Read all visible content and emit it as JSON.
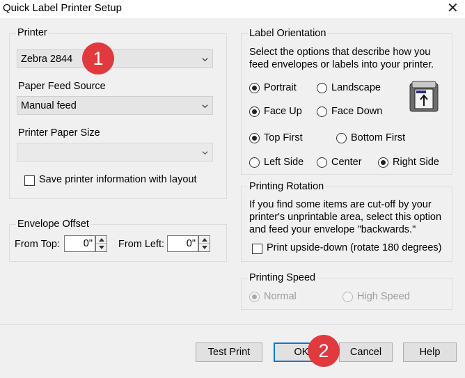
{
  "window": {
    "title": "Quick Label Printer Setup",
    "close_glyph": "✕"
  },
  "printer_group": {
    "legend": "Printer",
    "printer_selected": "Zebra 2844",
    "paper_feed_label": "Paper Feed Source",
    "paper_feed_selected": "Manual feed",
    "paper_size_label": "Printer Paper Size",
    "paper_size_selected": "",
    "save_info_label": "Save printer information with layout",
    "save_info_checked": false
  },
  "envelope_offset": {
    "legend": "Envelope Offset",
    "from_top_label": "From Top:",
    "from_top_value": "0\"",
    "from_left_label": "From Left:",
    "from_left_value": "0\""
  },
  "label_orientation": {
    "legend": "Label Orientation",
    "description": "Select the options that describe how you feed envelopes or labels into your printer.",
    "options": {
      "portrait": "Portrait",
      "landscape": "Landscape",
      "face_up": "Face Up",
      "face_down": "Face Down",
      "top_first": "Top First",
      "bottom_first": "Bottom First",
      "left_side": "Left Side",
      "center": "Center",
      "right_side": "Right Side"
    },
    "selected": {
      "orientation": "Portrait",
      "face": "Face Up",
      "order": "Top First",
      "side": "Right Side"
    },
    "preview_icon": "printer-feed-icon"
  },
  "printing_rotation": {
    "legend": "Printing Rotation",
    "description": "If you find some items are cut-off by your printer's unprintable area, select this option and feed your envelope \"backwards.\"",
    "checkbox_label": "Print upside-down (rotate 180 degrees)",
    "checked": false
  },
  "printing_speed": {
    "legend": "Printing Speed",
    "normal_label": "Normal",
    "high_label": "High Speed",
    "selected": "Normal",
    "enabled": false
  },
  "buttons": {
    "test_print": "Test Print",
    "ok": "OK",
    "cancel": "Cancel",
    "help": "Help"
  },
  "annotations": {
    "badge_1": "1",
    "badge_2": "2",
    "badge_color": "#e03a3e"
  },
  "colors": {
    "accent": "#0078d7",
    "dialog_bg": "#f0f0f0"
  }
}
